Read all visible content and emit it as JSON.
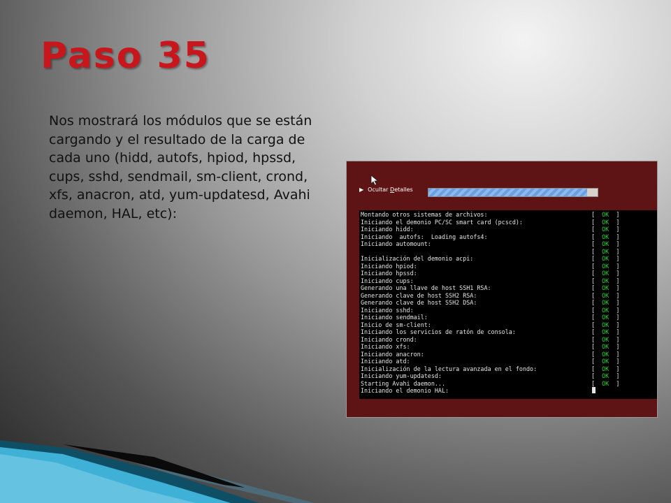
{
  "slide": {
    "title": "Paso 35",
    "body": "Nos mostrará los módulos que se están cargando y el resultado de la carga de cada uno (hidd, autofs, hpiod, hpssd, cups, sshd, sendmail, sm-client, crond, xfs, anacron, atd, yum-updatesd, Avahi daemon, HAL, etc):"
  },
  "screenshot": {
    "details_toggle": {
      "prefix": "Ocultar ",
      "underlined": "D",
      "suffix": "etalles"
    },
    "progress": 0.94,
    "status_ok": "OK",
    "terminal_lines": [
      {
        "text": "Montando otros sistemas de archivos:",
        "ok": true
      },
      {
        "text": "Iniciando el demonio PC/SC smart card (pcscd):",
        "ok": true
      },
      {
        "text": "Iniciando hidd:",
        "ok": true
      },
      {
        "text": "Iniciando  autofs:  Loading autofs4:",
        "ok": true
      },
      {
        "text": "Iniciando automount:",
        "ok": true
      },
      {
        "text": "",
        "ok": true
      },
      {
        "text": "Inicialización del demonio acpi:",
        "ok": true
      },
      {
        "text": "Iniciando hpiod:",
        "ok": true
      },
      {
        "text": "Iniciando hpssd:",
        "ok": true
      },
      {
        "text": "Iniciando cups:",
        "ok": true
      },
      {
        "text": "Generando una llave de host SSH1 RSA:",
        "ok": true
      },
      {
        "text": "Generando clave de host SSH2 RSA:",
        "ok": true
      },
      {
        "text": "Generando clave de host SSH2 DSA:",
        "ok": true
      },
      {
        "text": "Iniciando sshd:",
        "ok": true
      },
      {
        "text": "Iniciando sendmail:",
        "ok": true
      },
      {
        "text": "Inicio de sm-client:",
        "ok": true
      },
      {
        "text": "Iniciando los servicios de ratón de consola:",
        "ok": true
      },
      {
        "text": "Iniciando crond:",
        "ok": true
      },
      {
        "text": "Iniciando xfs:",
        "ok": true
      },
      {
        "text": "Iniciando anacron:",
        "ok": true
      },
      {
        "text": "Iniciando atd:",
        "ok": true
      },
      {
        "text": "Inicialización de la lectura avanzada en el fondo:",
        "ok": true
      },
      {
        "text": "Iniciando yum-updatesd:",
        "ok": true
      },
      {
        "text": "Starting Avahi daemon...",
        "ok": true
      },
      {
        "text": "Iniciando el demonio HAL:",
        "ok": false,
        "cursor": true
      }
    ]
  }
}
